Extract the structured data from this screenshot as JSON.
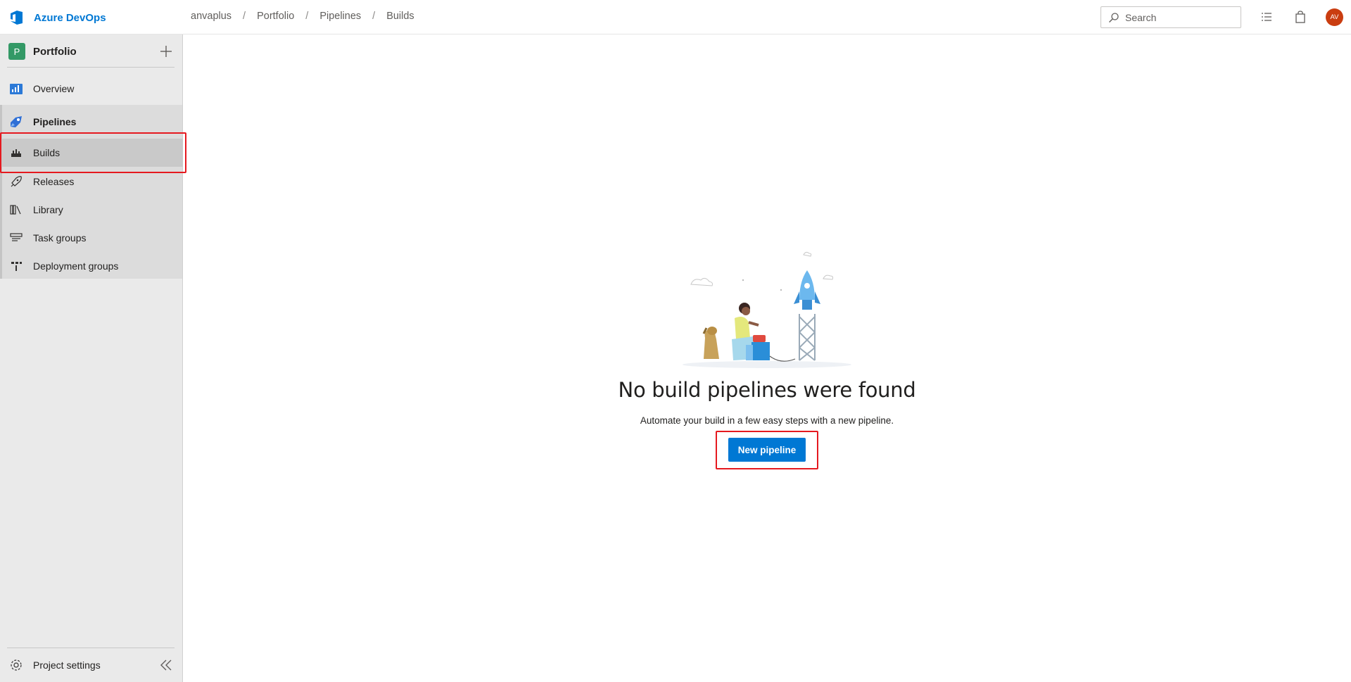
{
  "header": {
    "brand": "Azure DevOps",
    "breadcrumb": [
      "anvaplus",
      "Portfolio",
      "Pipelines",
      "Builds"
    ],
    "search_placeholder": "Search",
    "avatar_initials": "AV",
    "icons": [
      "list-icon",
      "shopping-bag-icon"
    ]
  },
  "sidebar": {
    "project": {
      "initial": "P",
      "name": "Portfolio",
      "badge_color": "#339966"
    },
    "items": [
      {
        "label": "Overview",
        "icon": "overview-icon"
      },
      {
        "label": "Pipelines",
        "icon": "pipelines-icon"
      }
    ],
    "sub_items": [
      {
        "label": "Builds",
        "icon": "builds-icon",
        "selected": true
      },
      {
        "label": "Releases",
        "icon": "rocket-icon"
      },
      {
        "label": "Library",
        "icon": "library-icon"
      },
      {
        "label": "Task groups",
        "icon": "task-groups-icon"
      },
      {
        "label": "Deployment groups",
        "icon": "deployment-groups-icon"
      }
    ],
    "footer": {
      "settings_label": "Project settings"
    }
  },
  "main": {
    "empty_state": {
      "title": "No build pipelines were found",
      "description": "Automate your build in a few easy steps with a new pipeline.",
      "button_label": "New pipeline"
    }
  },
  "colors": {
    "accent": "#0078d4",
    "avatar": "#ca3d10",
    "highlight": "#e5191f"
  }
}
